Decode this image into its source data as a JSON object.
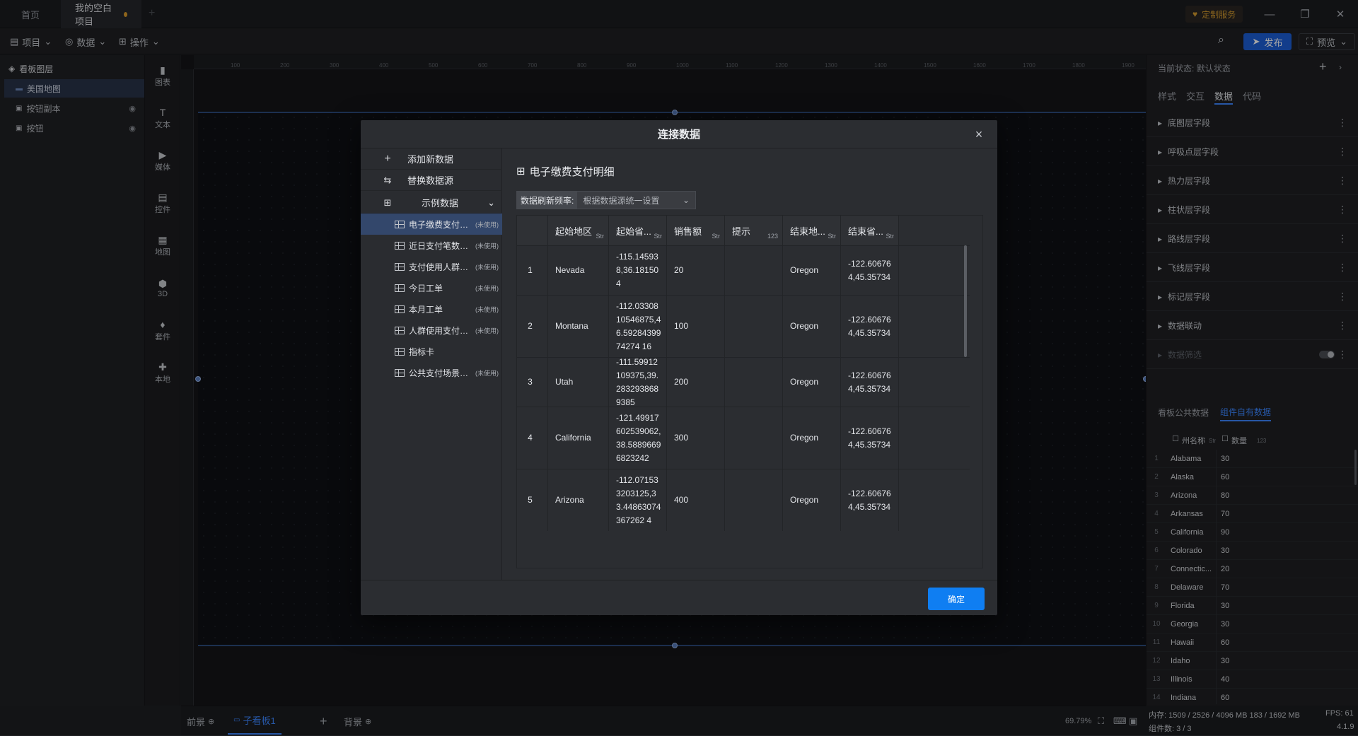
{
  "tabs": [
    {
      "label": "首页"
    },
    {
      "label": "我的空白项目"
    }
  ],
  "custom_service": "定制服务",
  "window": {
    "minimize": "—",
    "maximize": "❐",
    "close": "✕"
  },
  "menus": [
    {
      "label": "项目"
    },
    {
      "label": "数据"
    },
    {
      "label": "操作"
    }
  ],
  "publish_label": "发布",
  "preview_label": "预览",
  "layers": {
    "title": "看板图层",
    "items": [
      {
        "label": "美国地图"
      },
      {
        "label": "按钮副本"
      },
      {
        "label": "按钮"
      }
    ]
  },
  "tools": [
    {
      "label": "图表"
    },
    {
      "label": "文本"
    },
    {
      "label": "媒体"
    },
    {
      "label": "控件"
    },
    {
      "label": "地图"
    },
    {
      "label": "3D"
    },
    {
      "label": "套件"
    },
    {
      "label": "本地"
    }
  ],
  "ruler": [
    "100",
    "200",
    "300",
    "400",
    "500",
    "600",
    "700",
    "800",
    "900",
    "1000",
    "1100",
    "1200",
    "1300",
    "1400",
    "1500",
    "1600",
    "1700",
    "1800",
    "1900"
  ],
  "bottom": {
    "front": "前景",
    "sub_board": "子看板1",
    "add": "+",
    "background": "背景",
    "zoom": "69.79%"
  },
  "right": {
    "state_label": "当前状态:",
    "state_value": "默认状态",
    "tabs": [
      {
        "label": "样式"
      },
      {
        "label": "交互"
      },
      {
        "label": "数据"
      },
      {
        "label": "代码"
      }
    ],
    "sections": [
      {
        "label": "底图层字段"
      },
      {
        "label": "呼吸点层字段"
      },
      {
        "label": "热力层字段"
      },
      {
        "label": "柱状层字段"
      },
      {
        "label": "路线层字段"
      },
      {
        "label": "飞线层字段"
      },
      {
        "label": "标记层字段"
      },
      {
        "label": "数据联动"
      },
      {
        "label": "数据筛选"
      }
    ],
    "data_tabs": [
      {
        "label": "看板公共数据"
      },
      {
        "label": "组件自有数据"
      }
    ],
    "grid_headers": {
      "state": "州名称",
      "value": "数量",
      "type_s": "Str",
      "type_n": "123"
    },
    "rows": [
      {
        "n": "1",
        "s": "Alabama",
        "v": "30"
      },
      {
        "n": "2",
        "s": "Alaska",
        "v": "60"
      },
      {
        "n": "3",
        "s": "Arizona",
        "v": "80"
      },
      {
        "n": "4",
        "s": "Arkansas",
        "v": "70"
      },
      {
        "n": "5",
        "s": "California",
        "v": "90"
      },
      {
        "n": "6",
        "s": "Colorado",
        "v": "30"
      },
      {
        "n": "7",
        "s": "Connectic...",
        "v": "20"
      },
      {
        "n": "8",
        "s": "Delaware",
        "v": "70"
      },
      {
        "n": "9",
        "s": "Florida",
        "v": "30"
      },
      {
        "n": "10",
        "s": "Georgia",
        "v": "30"
      },
      {
        "n": "11",
        "s": "Hawaii",
        "v": "60"
      },
      {
        "n": "12",
        "s": "Idaho",
        "v": "30"
      },
      {
        "n": "13",
        "s": "Illinois",
        "v": "40"
      },
      {
        "n": "14",
        "s": "Indiana",
        "v": "60"
      }
    ]
  },
  "status": {
    "memory": "内存: 1509 / 2526 / 4096 MB 183 / 1692 MB",
    "fps": "FPS: 61",
    "components": "组件数: 3 / 3",
    "version": "4.1.9"
  },
  "modal": {
    "title": "连接数据",
    "add_new": "添加新数据",
    "replace": "替换数据源",
    "sample": "示例数据",
    "datasets": [
      {
        "name": "电子缴费支付明细",
        "badge": "(未使用)"
      },
      {
        "name": "近日支付笔数统计",
        "badge": "(未使用)"
      },
      {
        "name": "支付使用人群分布",
        "badge": "(未使用)"
      },
      {
        "name": "今日工单",
        "badge": "(未使用)"
      },
      {
        "name": "本月工单",
        "badge": "(未使用)"
      },
      {
        "name": "人群使用支付方式",
        "badge": "(未使用)"
      },
      {
        "name": "指标卡",
        "badge": ""
      },
      {
        "name": "公共支付场景分布",
        "badge": "(未使用)"
      }
    ],
    "table_title": "电子缴费支付明细",
    "refresh_label": "数据刷新频率:",
    "refresh_value": "根据数据源统一设置",
    "columns": [
      {
        "label": "",
        "type": ""
      },
      {
        "label": "起始地区",
        "type": "Str"
      },
      {
        "label": "起始省...",
        "type": "Str"
      },
      {
        "label": "销售额",
        "type": "Str"
      },
      {
        "label": "提示",
        "type": "123"
      },
      {
        "label": "结束地...",
        "type": "Str"
      },
      {
        "label": "结束省...",
        "type": "Str"
      }
    ],
    "rows": [
      {
        "i": "1",
        "a": "Nevada",
        "b": "-115.145938,36.181504",
        "c": "20",
        "d": "",
        "e": "Oregon",
        "f": "-122.606764,45.35734"
      },
      {
        "i": "2",
        "a": "Montana",
        "b": "-112.0330810546875,46.5928439974274 16",
        "c": "100",
        "d": "",
        "e": "Oregon",
        "f": "-122.606764,45.35734"
      },
      {
        "i": "3",
        "a": "Utah",
        "b": "-111.59912109375,39.2832938689385",
        "c": "200",
        "d": "",
        "e": "Oregon",
        "f": "-122.606764,45.35734"
      },
      {
        "i": "4",
        "a": "California",
        "b": "-121.49917602539062,38.58896696823242",
        "c": "300",
        "d": "",
        "e": "Oregon",
        "f": "-122.606764,45.35734"
      },
      {
        "i": "5",
        "a": "Arizona",
        "b": "-112.071533203125,33.44863074367262 4",
        "c": "400",
        "d": "",
        "e": "Oregon",
        "f": "-122.606764,45.35734"
      }
    ],
    "confirm": "确定"
  }
}
